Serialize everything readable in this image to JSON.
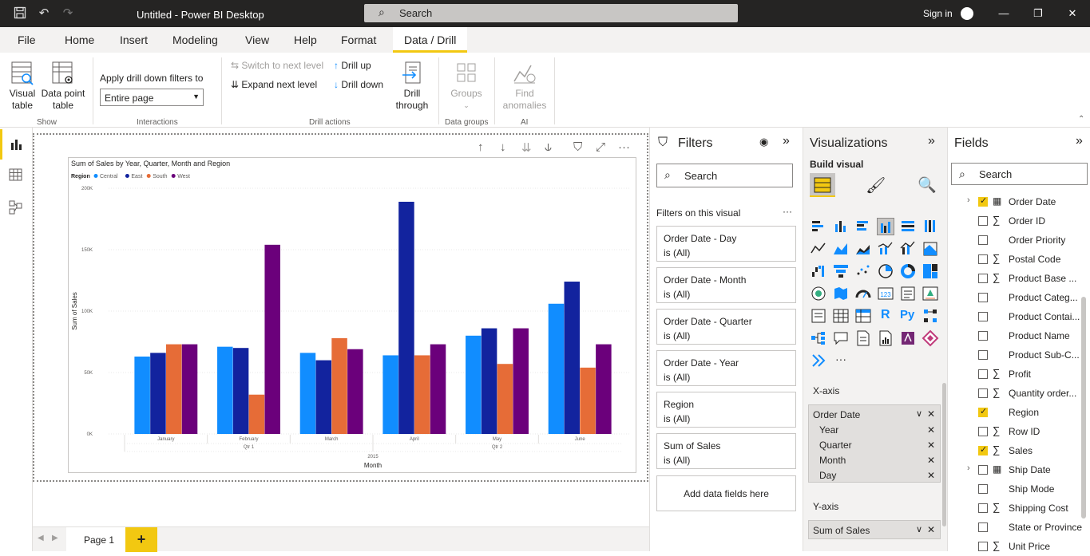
{
  "titlebar": {
    "title": "Untitled - Power BI Desktop",
    "search_label": "Search",
    "sign_in": "Sign in"
  },
  "tabs": [
    "File",
    "Home",
    "Insert",
    "Modeling",
    "View",
    "Help",
    "Format",
    "Data / Drill"
  ],
  "active_tab": "Data / Drill",
  "ribbon": {
    "visual_table": "Visual table",
    "data_point_table": "Data point table",
    "show_group": "Show",
    "apply_drill_label": "Apply drill down filters to",
    "entire_page": "Entire page",
    "interactions_group": "Interactions",
    "switch_next_level": "Switch to next level",
    "expand_next_level": "Expand next level",
    "drill_up": "Drill up",
    "drill_down": "Drill down",
    "drill_through": "Drill through",
    "drill_actions_group": "Drill actions",
    "groups": "Groups",
    "data_groups_group": "Data groups",
    "find_anomalies": "Find anomalies",
    "ai_group": "AI"
  },
  "chart_data": {
    "type": "bar",
    "title": "Sum of Sales by Year, Quarter, Month and Region",
    "legend_title": "Region",
    "legend_position": "top-left",
    "categories": [
      "January",
      "February",
      "March",
      "April",
      "May",
      "June"
    ],
    "quarter_labels": [
      "Qtr 1",
      "Qtr 2"
    ],
    "year_label": "2015",
    "xlabel": "Month",
    "ylabel": "Sum of Sales",
    "yticks": [
      "0K",
      "50K",
      "100K",
      "150K",
      "200K"
    ],
    "ylim": [
      0,
      200000
    ],
    "grid": true,
    "series": [
      {
        "name": "Central",
        "color": "#118dff",
        "values": [
          63000,
          71000,
          66000,
          64000,
          80000,
          106000
        ]
      },
      {
        "name": "East",
        "color": "#12239e",
        "values": [
          66000,
          70000,
          60000,
          189000,
          86000,
          124000
        ]
      },
      {
        "name": "South",
        "color": "#e66c37",
        "values": [
          73000,
          32000,
          78000,
          64000,
          57000,
          54000
        ]
      },
      {
        "name": "West",
        "color": "#6b007b",
        "values": [
          73000,
          154000,
          69000,
          73000,
          86000,
          73000
        ]
      }
    ]
  },
  "pages": {
    "page1": "Page 1",
    "add": "+"
  },
  "filters": {
    "title": "Filters",
    "search_placeholder": "Search",
    "section": "Filters on this visual",
    "cards": [
      {
        "name": "Order Date - Day",
        "state": "is (All)"
      },
      {
        "name": "Order Date - Month",
        "state": "is (All)"
      },
      {
        "name": "Order Date - Quarter",
        "state": "is (All)"
      },
      {
        "name": "Order Date - Year",
        "state": "is (All)"
      },
      {
        "name": "Region",
        "state": "is (All)"
      },
      {
        "name": "Sum of Sales",
        "state": "is (All)"
      }
    ],
    "add_fields": "Add data fields here"
  },
  "visualizations": {
    "title": "Visualizations",
    "build_visual": "Build visual",
    "xaxis_label": "X-axis",
    "xaxis_field": "Order Date",
    "xaxis_levels": [
      "Year",
      "Quarter",
      "Month",
      "Day"
    ],
    "yaxis_label": "Y-axis",
    "yaxis_field": "Sum of Sales",
    "more": "···"
  },
  "fields": {
    "title": "Fields",
    "search_placeholder": "Search",
    "items": [
      {
        "name": "Order Date",
        "checked": true,
        "sigma": false,
        "expander": true,
        "date": true
      },
      {
        "name": "Order ID",
        "checked": false,
        "sigma": true
      },
      {
        "name": "Order Priority",
        "checked": false,
        "sigma": false
      },
      {
        "name": "Postal Code",
        "checked": false,
        "sigma": true
      },
      {
        "name": "Product Base ...",
        "checked": false,
        "sigma": true
      },
      {
        "name": "Product Categ...",
        "checked": false,
        "sigma": false
      },
      {
        "name": "Product Contai...",
        "checked": false,
        "sigma": false
      },
      {
        "name": "Product Name",
        "checked": false,
        "sigma": false
      },
      {
        "name": "Product Sub-C...",
        "checked": false,
        "sigma": false
      },
      {
        "name": "Profit",
        "checked": false,
        "sigma": true
      },
      {
        "name": "Quantity order...",
        "checked": false,
        "sigma": true
      },
      {
        "name": "Region",
        "checked": true,
        "sigma": false
      },
      {
        "name": "Row ID",
        "checked": false,
        "sigma": true
      },
      {
        "name": "Sales",
        "checked": true,
        "sigma": true
      },
      {
        "name": "Ship Date",
        "checked": false,
        "sigma": false,
        "expander": true,
        "date": true
      },
      {
        "name": "Ship Mode",
        "checked": false,
        "sigma": false
      },
      {
        "name": "Shipping Cost",
        "checked": false,
        "sigma": true
      },
      {
        "name": "State or Province",
        "checked": false,
        "sigma": false
      },
      {
        "name": "Unit Price",
        "checked": false,
        "sigma": true
      }
    ]
  }
}
